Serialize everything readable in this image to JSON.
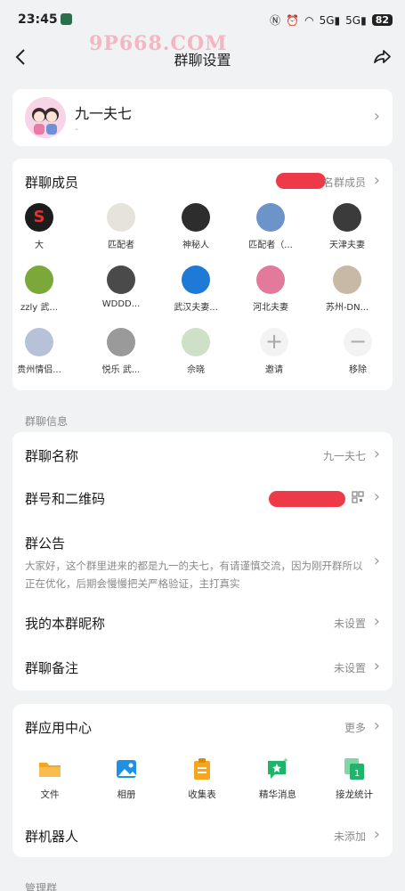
{
  "status_bar": {
    "time": "23:45",
    "battery": "82",
    "signal1": "5G",
    "signal2": "5G"
  },
  "nav": {
    "title": "群聊设置",
    "watermark": "9P668.COM"
  },
  "group": {
    "name": "九一夫七",
    "sub": "-"
  },
  "members": {
    "title": "群聊成员",
    "count_suffix": "名群成员",
    "list": [
      {
        "name": "大",
        "color": "#1c1c1c",
        "glyph": "S"
      },
      {
        "name": "匹配者",
        "color": "#e6e2dc",
        "glyph": ""
      },
      {
        "name": "神秘人",
        "color": "#2d2d2d",
        "glyph": ""
      },
      {
        "name": "匹配者（...",
        "color": "#6c94c8",
        "glyph": ""
      },
      {
        "name": "天津夫妻",
        "color": "#3b3b3b",
        "glyph": ""
      },
      {
        "name": "zzly 武...",
        "color": "#7aa83a",
        "glyph": ""
      },
      {
        "name": "WDDD...",
        "color": "#4a4a4a",
        "glyph": ""
      },
      {
        "name": "武汉夫妻...",
        "color": "#1e7ad6",
        "glyph": ""
      },
      {
        "name": "河北夫妻",
        "color": "#e27a9c",
        "glyph": ""
      },
      {
        "name": "苏州-DN...",
        "color": "#c8b8a6",
        "glyph": ""
      },
      {
        "name": "贵州情侣...",
        "color": "#b7c2d8",
        "glyph": ""
      },
      {
        "name": "悦乐 武...",
        "color": "#9a9a9a",
        "glyph": ""
      },
      {
        "name": "佘晓",
        "color": "#cfe0c8",
        "glyph": ""
      }
    ],
    "invite_label": "邀请",
    "remove_label": "移除"
  },
  "info_section": {
    "label": "群聊信息",
    "name_row": {
      "title": "群聊名称",
      "value": "九一夫七"
    },
    "qr_row": {
      "title": "群号和二维码"
    },
    "notice_row": {
      "title": "群公告",
      "text": "大家好，这个群里进来的都是九一的夫七，有请谨慎交流，因为刚开群所以正在优化，后期会慢慢把关严格验证，主打真实"
    },
    "nickname_row": {
      "title": "我的本群昵称",
      "value": "未设置"
    },
    "remark_row": {
      "title": "群聊备注",
      "value": "未设置"
    }
  },
  "apps": {
    "title": "群应用中心",
    "more": "更多",
    "items": [
      {
        "label": "文件",
        "icon": "folder-icon",
        "color": "#f4a623"
      },
      {
        "label": "相册",
        "icon": "photo-album-icon",
        "color": "#1e90e6"
      },
      {
        "label": "收集表",
        "icon": "clipboard-icon",
        "color": "#f4a623"
      },
      {
        "label": "精华消息",
        "icon": "chat-star-icon",
        "color": "#20b36b"
      },
      {
        "label": "接龙统计",
        "icon": "copy-icon",
        "color": "#20b36b"
      }
    ],
    "robot_row": {
      "title": "群机器人",
      "value": "未添加"
    }
  },
  "manage_section": {
    "label": "管理群"
  }
}
